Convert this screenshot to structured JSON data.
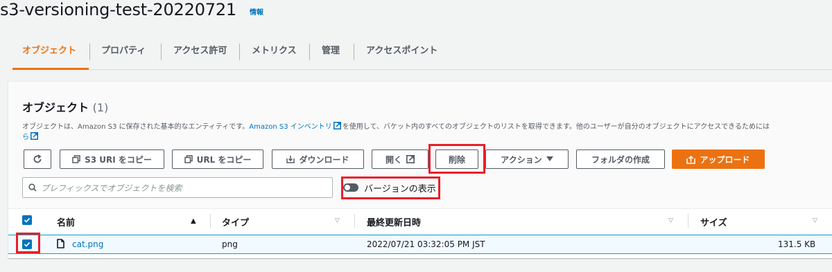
{
  "page": {
    "title": "s3-versioning-test-20220721",
    "info_label": "情報"
  },
  "tabs": [
    {
      "label": "オブジェクト",
      "active": true
    },
    {
      "label": "プロパティ",
      "active": false
    },
    {
      "label": "アクセス許可",
      "active": false
    },
    {
      "label": "メトリクス",
      "active": false
    },
    {
      "label": "管理",
      "active": false
    },
    {
      "label": "アクセスポイント",
      "active": false
    }
  ],
  "objects_panel": {
    "heading": "オブジェクト",
    "count": "(1)",
    "description_before": "オブジェクトは、Amazon S3 に保存された基本的なエンティティです。",
    "inventory_link": "Amazon S3 インベントリ",
    "description_after": "を使用して、バケット内のすべてのオブジェクトのリストを取得できます。他のユーザーが自分のオブジェクトにアクセスできるためには",
    "description_wrap": "ら"
  },
  "toolbar": {
    "copy_s3_uri": "S3 URI をコピー",
    "copy_url": "URL をコピー",
    "download": "ダウンロード",
    "open": "開く",
    "delete": "削除",
    "actions": "アクション",
    "create_folder": "フォルダの作成",
    "upload": "アップロード"
  },
  "search": {
    "placeholder": "プレフィックスでオブジェクトを検索"
  },
  "versions_toggle": {
    "label": "バージョンの表示",
    "enabled": false
  },
  "table": {
    "columns": [
      "名前",
      "タイプ",
      "最終更新日時",
      "サイズ"
    ],
    "rows": [
      {
        "name": "cat.png",
        "type": "png",
        "last_modified": "2022/07/21 03:32:05 PM JST",
        "size": "131.5 KB",
        "selected": true
      }
    ]
  },
  "colors": {
    "accent": "#ec7211",
    "link": "#0073bb",
    "highlight": "#e8202a"
  }
}
